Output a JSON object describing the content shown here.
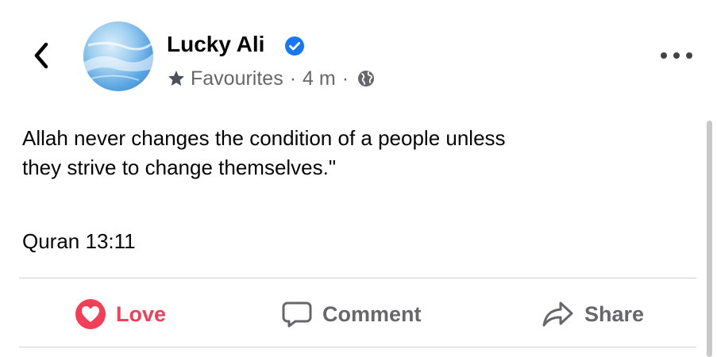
{
  "header": {
    "back_icon": "chevron-left-icon",
    "author_name": "Lucky Ali",
    "verified_icon": "verified-badge-icon",
    "audience_icon": "star-icon",
    "audience_label": "Favourites",
    "separator": "·",
    "timestamp": "4 m",
    "privacy_icon": "globe-icon",
    "more_icon": "more-horizontal-icon"
  },
  "post": {
    "text_lines": [
      "Allah never changes the condition of a people unless",
      "they strive to change themselves.\""
    ],
    "reference": "Quran 13:11"
  },
  "actions": {
    "love_label": "Love",
    "love_icon": "love-reaction-icon",
    "comment_label": "Comment",
    "comment_icon": "comment-icon",
    "share_label": "Share",
    "share_icon": "share-icon"
  },
  "colors": {
    "text": "#050505",
    "secondary": "#65676b",
    "verified": "#1877f2",
    "love": "#f33e58",
    "divider": "#ced0d4"
  }
}
